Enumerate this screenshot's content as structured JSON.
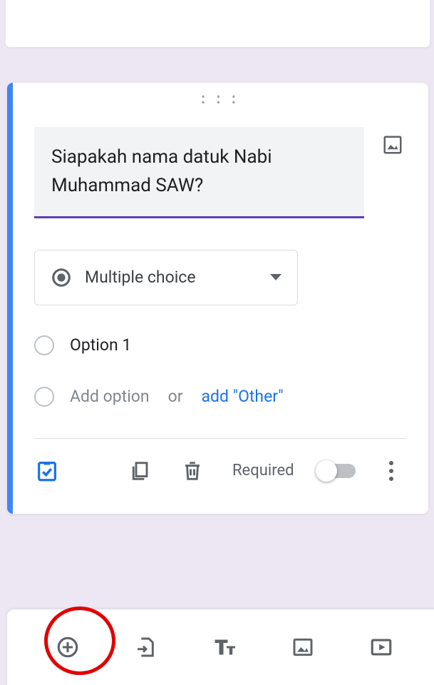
{
  "question": {
    "text": "Siapakah nama datuk Nabi Muhammad SAW?"
  },
  "type_selector": {
    "label": "Multiple choice"
  },
  "options": {
    "first": "Option 1",
    "add_option": "Add option",
    "or": "or",
    "add_other": "add \"Other\""
  },
  "footer": {
    "required": "Required"
  }
}
